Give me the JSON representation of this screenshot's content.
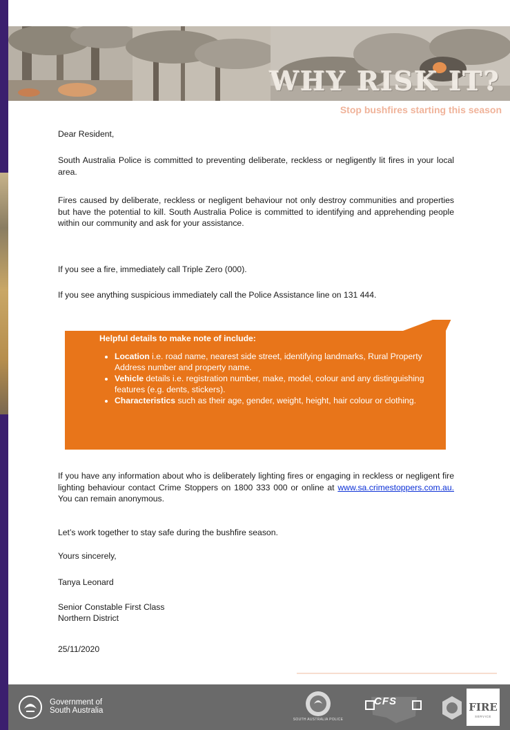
{
  "banner": {
    "title": "WHY RISK IT?",
    "tagline": "Stop bushfires starting this season"
  },
  "letter": {
    "salutation": "Dear Resident,",
    "p1": "South Australia Police is committed to preventing deliberate, reckless or negligently lit fires in your local area.",
    "p2": "Fires caused by deliberate, reckless or negligent behaviour not only destroy communities and properties but have the potential to kill. South Australia Police is committed to identifying and apprehending people within our community and ask for your assistance.",
    "p3": "If you see a fire, immediately call Triple Zero (000).",
    "p4": "If you see anything suspicious immediately call the Police Assistance line on 131 444.",
    "callout": {
      "title": "Helpful details to make note of include:",
      "items": [
        {
          "bold": "Location",
          "text": " i.e. road name, nearest side street, identifying landmarks, Rural Property Address number and property name."
        },
        {
          "bold": "Vehicle",
          "text": " details i.e. registration number, make, model, colour and any distinguishing features (e.g. dents, stickers)."
        },
        {
          "bold": "Characteristics",
          "text": " such as their age, gender, weight, height, hair colour or clothing."
        }
      ]
    },
    "p5_before": "If you have any information about who is deliberately lighting fires or engaging in reckless or negligent fire lighting behaviour contact Crime Stoppers on 1800 333 000 or online at ",
    "p5_link": "www.sa.crimestoppers.com.au.",
    "p5_after": " You can remain anonymous.",
    "p6": "Let’s work together to stay safe during the bushfire season.",
    "closing": "Yours sincerely,",
    "signer_name": "Tanya Leonard",
    "signer_title": "Senior Constable First Class",
    "signer_district": "Northern District",
    "date": "25/11/2020"
  },
  "footer": {
    "gov_line1": "Government of",
    "gov_line2": "South Australia",
    "police_label": "SOUTH AUSTRALIA POLICE",
    "cfs_label": "CFS",
    "fire_label": "FIRE",
    "fire_sub": "SERVICE"
  },
  "colors": {
    "orange": "#e8751a",
    "footer_gray": "#6a6a6a",
    "purple_strip": "#3b1f6e",
    "link_blue": "#0a2fd6"
  }
}
